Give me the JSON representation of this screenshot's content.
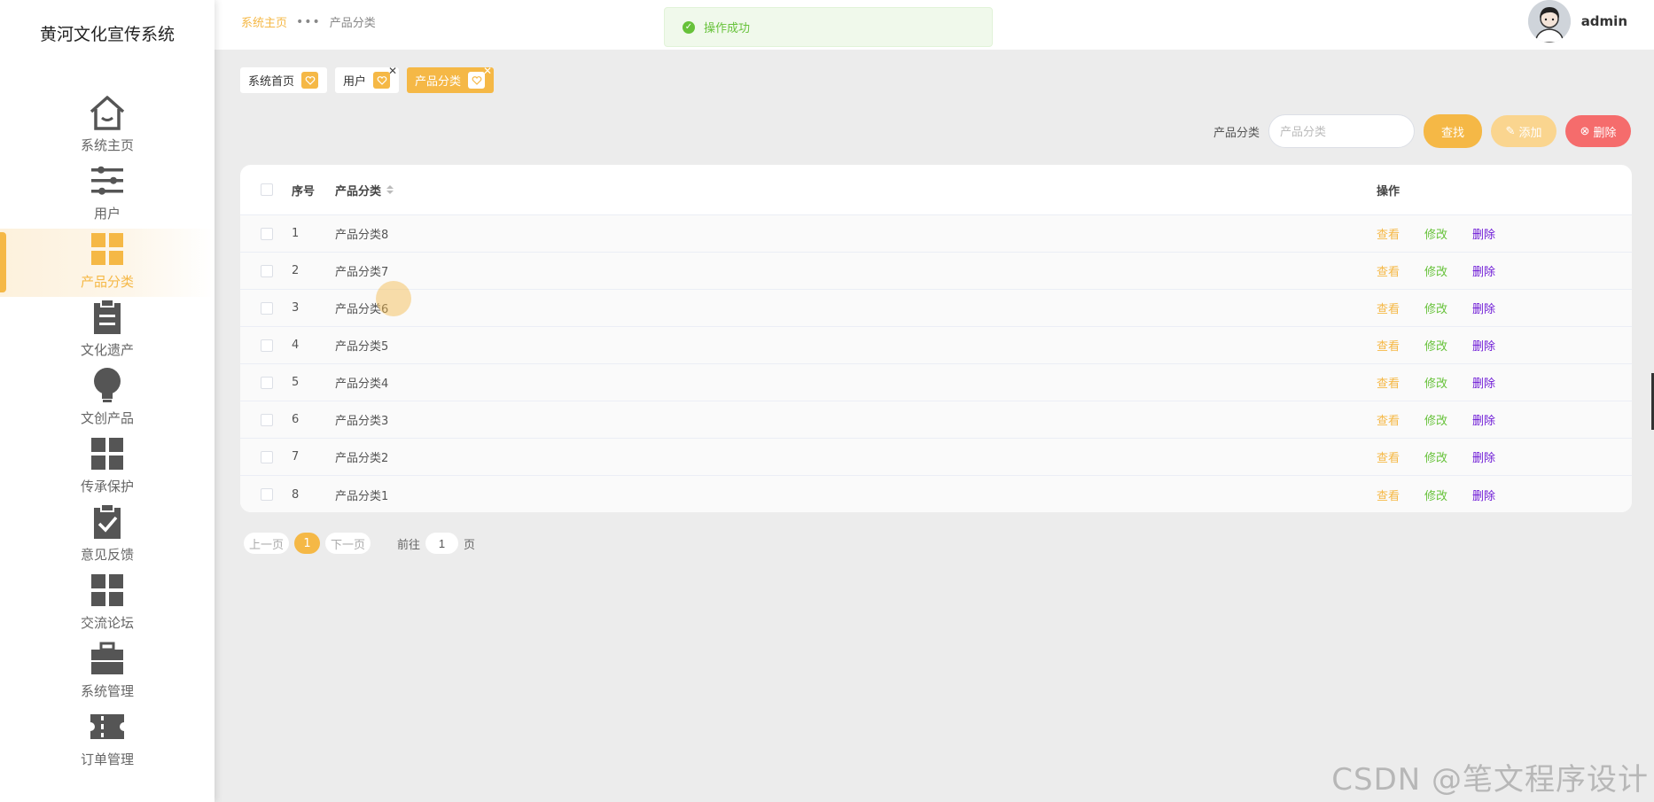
{
  "sidebar": {
    "title": "黄河文化宣传系统",
    "items": [
      {
        "label": "系统主页",
        "icon": "home-icon"
      },
      {
        "label": "用户",
        "icon": "sliders-icon"
      },
      {
        "label": "产品分类",
        "icon": "grid-icon",
        "active": true
      },
      {
        "label": "文化遗产",
        "icon": "clipboard-icon"
      },
      {
        "label": "文创产品",
        "icon": "bulb-icon"
      },
      {
        "label": "传承保护",
        "icon": "grid-icon"
      },
      {
        "label": "意见反馈",
        "icon": "clipboard-check-icon"
      },
      {
        "label": "交流论坛",
        "icon": "grid-icon"
      },
      {
        "label": "系统管理",
        "icon": "briefcase-icon"
      },
      {
        "label": "订单管理",
        "icon": "ticket-icon"
      }
    ]
  },
  "breadcrumb": {
    "home": "系统主页",
    "separator": "•••",
    "current": "产品分类"
  },
  "user": {
    "name": "admin"
  },
  "toast": {
    "text": "操作成功"
  },
  "tags": [
    {
      "label": "系统首页"
    },
    {
      "label": "用户",
      "closable": true
    },
    {
      "label": "产品分类",
      "closable": true,
      "active": true
    }
  ],
  "search": {
    "label": "产品分类",
    "placeholder": "产品分类",
    "search_btn": "查找",
    "add_btn": "添加",
    "delete_btn": "删除"
  },
  "table": {
    "headers": {
      "index": "序号",
      "name": "产品分类",
      "ops": "操作"
    },
    "ops": {
      "view": "查看",
      "edit": "修改",
      "delete": "删除"
    },
    "rows": [
      {
        "index": "1",
        "name": "产品分类8"
      },
      {
        "index": "2",
        "name": "产品分类7"
      },
      {
        "index": "3",
        "name": "产品分类6"
      },
      {
        "index": "4",
        "name": "产品分类5"
      },
      {
        "index": "5",
        "name": "产品分类4"
      },
      {
        "index": "6",
        "name": "产品分类3"
      },
      {
        "index": "7",
        "name": "产品分类2"
      },
      {
        "index": "8",
        "name": "产品分类1"
      }
    ]
  },
  "pagination": {
    "prev": "上一页",
    "current": "1",
    "next": "下一页",
    "goto_label": "前往",
    "goto_value": "1",
    "page_unit": "页"
  },
  "watermark": "CSDN @笔文程序设计",
  "colors": {
    "accent": "#f5b846",
    "success": "#67c23a",
    "danger": "#f56c6c",
    "purple": "#6e1ad6"
  }
}
